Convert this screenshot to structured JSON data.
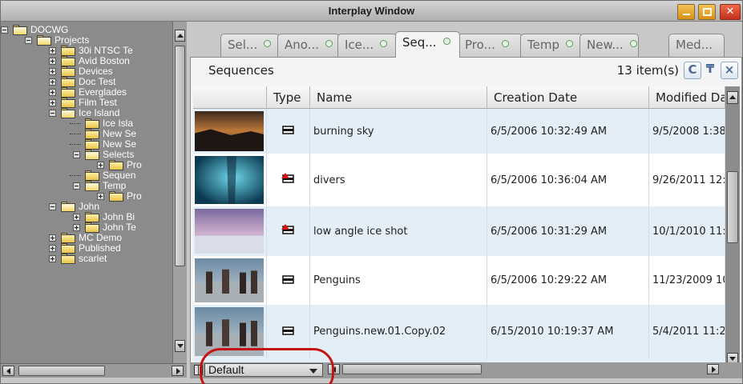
{
  "window": {
    "title": "Interplay Window"
  },
  "tree": {
    "items": [
      {
        "label": "DOCWG",
        "expander": "minus",
        "open": true
      },
      {
        "label": "Projects",
        "expander": "minus",
        "open": true
      },
      {
        "label": "30i NTSC Te",
        "expander": "plus",
        "open": false
      },
      {
        "label": "Avid Boston",
        "expander": "plus",
        "open": false
      },
      {
        "label": "Devices",
        "expander": "plus",
        "open": false
      },
      {
        "label": "Doc Test",
        "expander": "plus",
        "open": false
      },
      {
        "label": "Everglades",
        "expander": "plus",
        "open": false
      },
      {
        "label": "Film Test",
        "expander": "plus",
        "open": false
      },
      {
        "label": "Ice Island",
        "expander": "minus",
        "open": true
      },
      {
        "label": "Ice Isla",
        "expander": "none",
        "open": false
      },
      {
        "label": "New Se",
        "expander": "none",
        "open": false
      },
      {
        "label": "New Se",
        "expander": "none",
        "open": false
      },
      {
        "label": "Selects",
        "expander": "minus",
        "open": true
      },
      {
        "label": "Pro",
        "expander": "plus",
        "open": false
      },
      {
        "label": "Sequen",
        "expander": "none",
        "open": false,
        "selected": true
      },
      {
        "label": "Temp",
        "expander": "minus",
        "open": true
      },
      {
        "label": "Pro",
        "expander": "plus",
        "open": false
      },
      {
        "label": "John",
        "expander": "minus",
        "open": true
      },
      {
        "label": "John Bi",
        "expander": "plus",
        "open": false
      },
      {
        "label": "John Te",
        "expander": "plus",
        "open": false
      },
      {
        "label": "MC Demo",
        "expander": "plus",
        "open": false
      },
      {
        "label": "Published",
        "expander": "plus",
        "open": false
      },
      {
        "label": "scarlet",
        "expander": "plus",
        "open": false
      }
    ]
  },
  "tabs": [
    {
      "label": "Sel...",
      "active": false
    },
    {
      "label": "Ano...",
      "active": false
    },
    {
      "label": "Ice...",
      "active": false
    },
    {
      "label": "Seq...",
      "active": true
    },
    {
      "label": "Pro...",
      "active": false
    },
    {
      "label": "Temp",
      "active": false
    },
    {
      "label": "New...",
      "active": false
    },
    {
      "label": "Med...",
      "active": false
    }
  ],
  "panel": {
    "title": "Sequences",
    "item_count": "13 item(s)",
    "refresh_glyph": "C",
    "pin_glyph": "₸",
    "close_glyph": "×"
  },
  "columns": [
    "",
    "Type",
    "Name",
    "Creation Date",
    "Modified Da"
  ],
  "rows": [
    {
      "thumb": "sky",
      "type_icon": "sequence-icon",
      "name": "burning sky",
      "created": "6/5/2006 10:32:49 AM",
      "modified": "9/5/2008 1:38"
    },
    {
      "thumb": "underwater",
      "type_icon": "sequence-alert-icon",
      "name": "divers",
      "created": "6/5/2006 10:36:04 AM",
      "modified": "9/26/2011 12:"
    },
    {
      "thumb": "ice",
      "type_icon": "sequence-alert-icon",
      "name": "low angle ice shot",
      "created": "6/5/2006 10:31:29 AM",
      "modified": "10/1/2010 11:"
    },
    {
      "thumb": "people",
      "type_icon": "sequence-icon",
      "name": "Penguins",
      "created": "6/5/2006 10:29:22 AM",
      "modified": "11/23/2009 10"
    },
    {
      "thumb": "people2",
      "type_icon": "sequence-icon",
      "name": "Penguins.new.01.Copy.02",
      "created": "6/15/2010 10:19:37 AM",
      "modified": "5/4/2011 11:2"
    }
  ],
  "bottom": {
    "view_label": "Default"
  },
  "colors": {
    "highlight": "#c41414",
    "row_alt": "#e4eef6",
    "window_bg": "#c8c8c8",
    "alert": "#e01010"
  }
}
